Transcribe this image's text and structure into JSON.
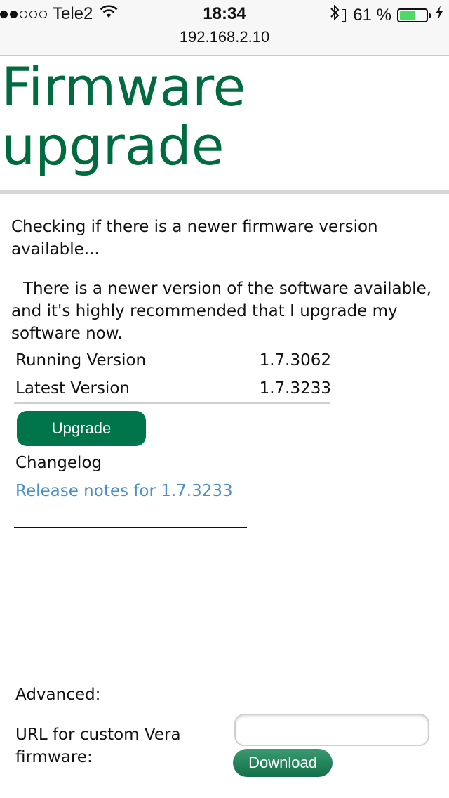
{
  "status_bar": {
    "carrier": "Tele2",
    "signal_bars_filled": 2,
    "signal_bars_total": 5,
    "time": "18:34",
    "battery_percent": "61 %",
    "battery_level": 0.61,
    "icons": [
      "wifi-icon",
      "bluetooth-icon",
      "battery-icon",
      "charging-bolt-icon"
    ]
  },
  "browser": {
    "url": "192.168.2.10"
  },
  "page": {
    "title": "Firmware upgrade",
    "checking_text": "Checking if there is a newer firmware version available...",
    "notice_text": "There is a newer version of the software available, and it's highly recommended that I upgrade my software now.",
    "versions": [
      {
        "label": "Running Version",
        "value": "1.7.3062"
      },
      {
        "label": "Latest Version",
        "value": "1.7.3233"
      }
    ],
    "upgrade_button": "Upgrade",
    "changelog_label": "Changelog",
    "release_notes_link": "Release notes for 1.7.3233",
    "advanced_label": "Advanced:",
    "custom_url_label": "URL for custom Vera firmware:",
    "custom_url_value": "",
    "download_button": "Download"
  },
  "colors": {
    "title_green": "#006b3f",
    "button_green": "#00744a",
    "link_blue": "#4a90c6",
    "battery_green": "#4cd964"
  }
}
